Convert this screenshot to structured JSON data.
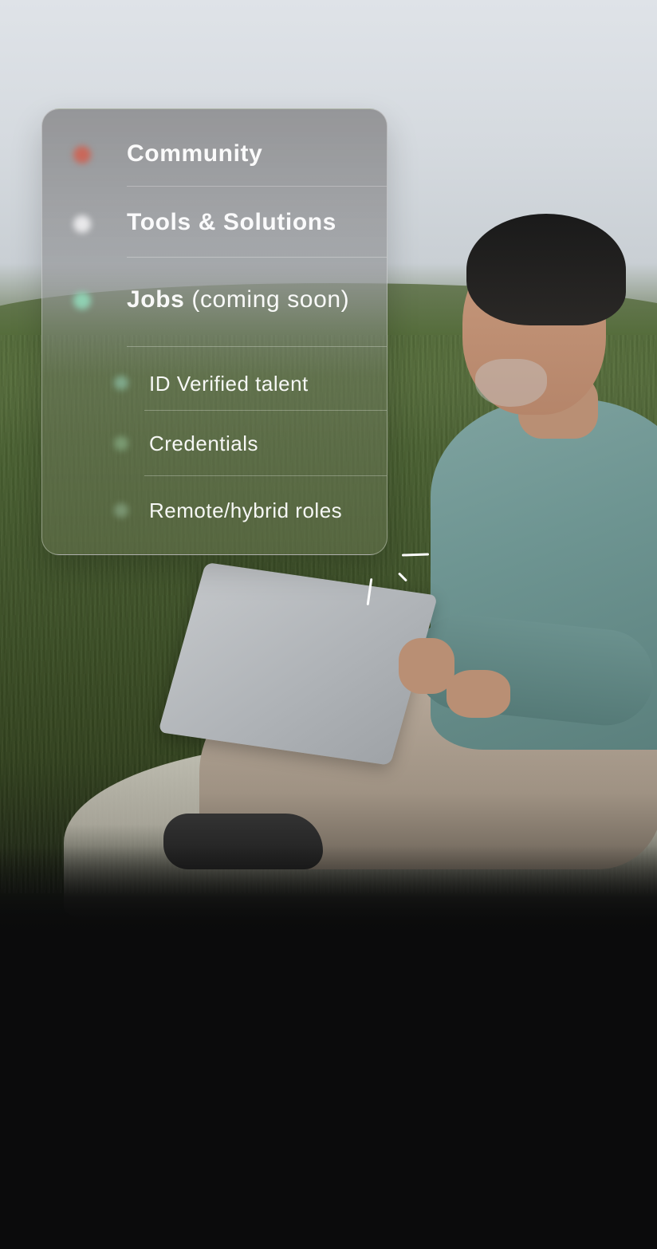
{
  "menu": {
    "items": [
      {
        "label": "Community",
        "bullet_color": "#c9685a",
        "level": "primary"
      },
      {
        "label": "Tools & Solutions",
        "bullet_color": "#e8e8ea",
        "level": "primary"
      },
      {
        "label_bold": "Jobs",
        "label_rest": "(coming soon)",
        "bullet_color": "#8fd0b2",
        "level": "primary"
      },
      {
        "label": "ID Verified talent",
        "bullet_color": "#7fa88a",
        "level": "secondary"
      },
      {
        "label": "Credentials",
        "bullet_color": "#7a9a72",
        "level": "secondary"
      },
      {
        "label": "Remote/hybrid roles",
        "bullet_color": "#7a9572",
        "level": "secondary"
      }
    ]
  },
  "colors": {
    "page_background": "#0b0b0c",
    "menu_text": "#ffffff"
  }
}
